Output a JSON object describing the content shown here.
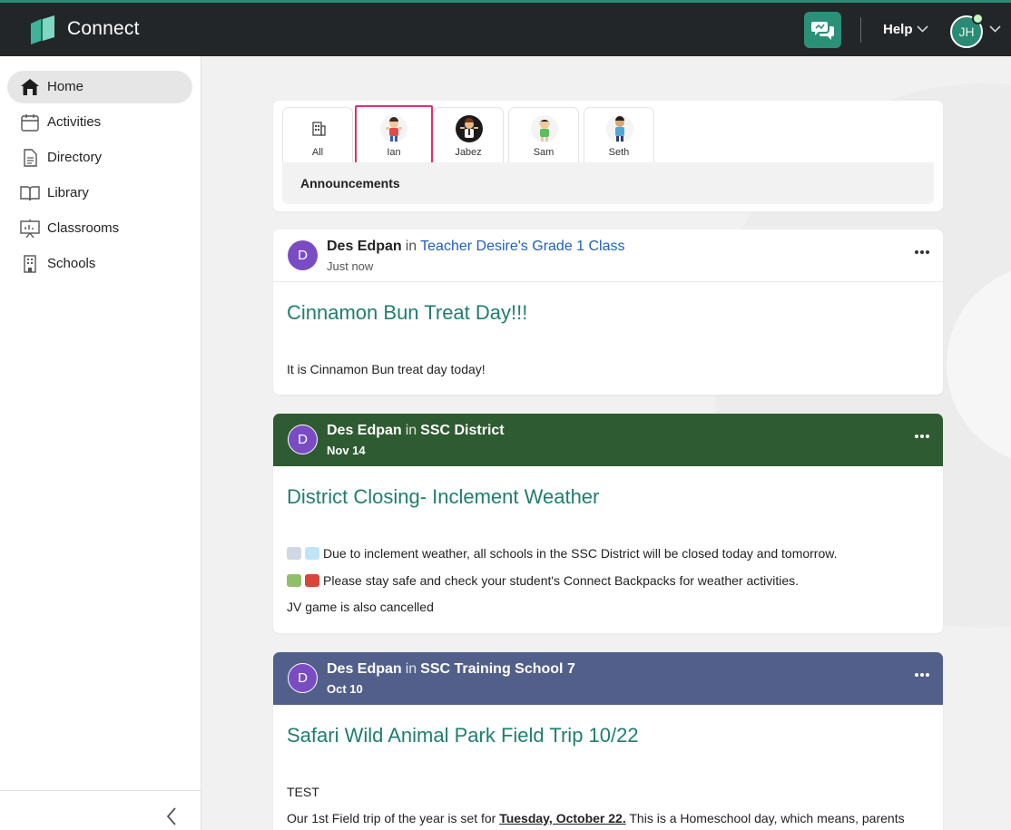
{
  "app": {
    "name": "Connect",
    "help_label": "Help",
    "user_initials": "JH"
  },
  "sidebar": {
    "items": [
      {
        "label": "Home",
        "icon": "home-icon",
        "active": true
      },
      {
        "label": "Activities",
        "icon": "calendar-icon"
      },
      {
        "label": "Directory",
        "icon": "document-icon"
      },
      {
        "label": "Library",
        "icon": "book-icon"
      },
      {
        "label": "Classrooms",
        "icon": "presentation-board-icon"
      },
      {
        "label": "Schools",
        "icon": "building-icon"
      }
    ]
  },
  "filter": {
    "tabs": [
      {
        "label": "All",
        "icon": "building-icon"
      },
      {
        "label": "Ian",
        "icon": "child-avatar-icon",
        "selected": true
      },
      {
        "label": "Jabez",
        "icon": "child-avatar-icon"
      },
      {
        "label": "Sam",
        "icon": "child-avatar-icon"
      },
      {
        "label": "Seth",
        "icon": "child-avatar-icon"
      }
    ],
    "section_label": "Announcements"
  },
  "posts": [
    {
      "author": "Des Edpan",
      "in_word": "in",
      "group": "Teacher Desire's Grade 1 Class",
      "date": "Just now",
      "avatar_letter": "D",
      "header_color": "#ffffff",
      "title": "Cinnamon Bun Treat Day!!!",
      "body": [
        "It is Cinnamon Bun treat day today!"
      ]
    },
    {
      "author": "Des Edpan",
      "in_word": "in",
      "group": "SSC District",
      "date": "Nov 14",
      "avatar_letter": "D",
      "header_color": "#2e5b31",
      "title": "District Closing- Inclement Weather",
      "body": [
        "Due to inclement weather, all schools in the SSC District will be closed today and tomorrow.",
        "Please stay safe and check your student's Connect Backpacks for weather activities.",
        "JV game is also cancelled"
      ]
    },
    {
      "author": "Des Edpan",
      "in_word": "in",
      "group": "SSC Training School 7",
      "date": "Oct 10",
      "avatar_letter": "D",
      "header_color": "#525f8a",
      "title": "Safari Wild Animal Park Field Trip 10/22",
      "body": [
        "TEST",
        "Our 1st Field trip of the year is set for",
        "Tuesday, October 22.",
        "This is a Homeschool day, which means, parents"
      ]
    }
  ],
  "colors": {
    "topbar": "#232629",
    "accent": "#2a8a73",
    "title_green": "#1f7e6e",
    "link_blue": "#1f5fbf",
    "selected_border": "#e0306a"
  }
}
